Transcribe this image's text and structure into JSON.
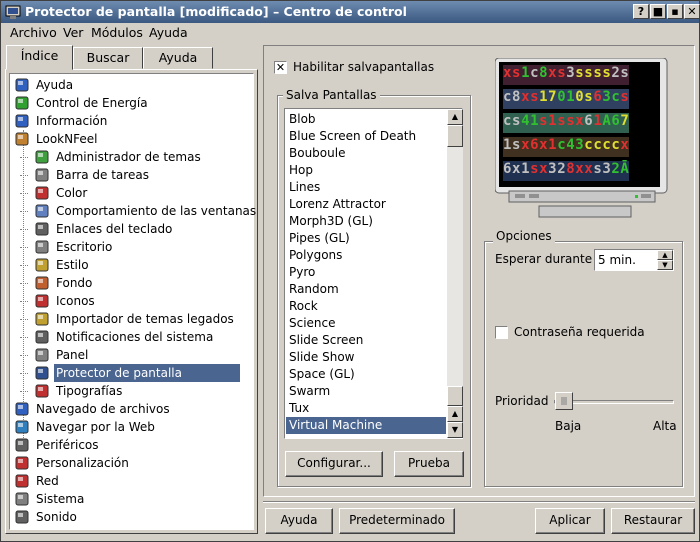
{
  "window": {
    "title": "Protector de pantalla [modificado] – Centro de control",
    "controls": [
      "?",
      "■",
      "▪",
      "✕"
    ]
  },
  "menu": [
    "Archivo",
    "Ver",
    "Módulos",
    "Ayuda"
  ],
  "tabs": [
    "Índice",
    "Buscar",
    "Ayuda"
  ],
  "tree": [
    {
      "label": "Ayuda",
      "icon": "help-icon",
      "level": 0
    },
    {
      "label": "Control de Energía",
      "icon": "energy-icon",
      "level": 0
    },
    {
      "label": "Información",
      "icon": "info-icon",
      "level": 0
    },
    {
      "label": "LookNFeel",
      "icon": "looknfeel-icon",
      "level": 0
    },
    {
      "label": "Administrador de temas",
      "icon": "theme-manager-icon",
      "level": 1
    },
    {
      "label": "Barra de tareas",
      "icon": "taskbar-icon",
      "level": 1
    },
    {
      "label": "Color",
      "icon": "color-icon",
      "level": 1
    },
    {
      "label": "Comportamiento de las ventanas",
      "icon": "window-behavior-icon",
      "level": 1
    },
    {
      "label": "Enlaces del teclado",
      "icon": "keyboard-icon",
      "level": 1
    },
    {
      "label": "Escritorio",
      "icon": "desktop-icon",
      "level": 1
    },
    {
      "label": "Estilo",
      "icon": "style-icon",
      "level": 1
    },
    {
      "label": "Fondo",
      "icon": "background-icon",
      "level": 1
    },
    {
      "label": "Iconos",
      "icon": "icons-icon",
      "level": 1
    },
    {
      "label": "Importador de temas legados",
      "icon": "theme-importer-icon",
      "level": 1
    },
    {
      "label": "Notificaciones del sistema",
      "icon": "notifications-icon",
      "level": 1
    },
    {
      "label": "Panel",
      "icon": "panel-icon",
      "level": 1
    },
    {
      "label": "Protector de pantalla",
      "icon": "screensaver-icon",
      "level": 1,
      "selected": true
    },
    {
      "label": "Tipografías",
      "icon": "fonts-icon",
      "level": 1
    },
    {
      "label": "Navegado de archivos",
      "icon": "file-browsing-icon",
      "level": 0
    },
    {
      "label": "Navegar por la Web",
      "icon": "web-icon",
      "level": 0
    },
    {
      "label": "Periféricos",
      "icon": "peripherals-icon",
      "level": 0
    },
    {
      "label": "Personalización",
      "icon": "personalization-icon",
      "level": 0
    },
    {
      "label": "Red",
      "icon": "network-icon",
      "level": 0
    },
    {
      "label": "Sistema",
      "icon": "system-icon",
      "level": 0
    },
    {
      "label": "Sonido",
      "icon": "sound-icon",
      "level": 0
    }
  ],
  "enable": {
    "label": "Habilitar salvapantallas",
    "checked": true
  },
  "savers": {
    "title": "Salva Pantallas",
    "items": [
      "Blob",
      "Blue Screen of Death",
      "Bouboule",
      "Hop",
      "Lines",
      "Lorenz Attractor",
      "Morph3D (GL)",
      "Pipes (GL)",
      "Polygons",
      "Pyro",
      "Random",
      "Rock",
      "Science",
      "Slide Screen",
      "Slide Show",
      "Space (GL)",
      "Swarm",
      "Tux",
      "Virtual Machine"
    ],
    "selected": "Virtual Machine",
    "configure": "Configurar...",
    "test": "Prueba"
  },
  "preview": {
    "rows": [
      [
        [
          "x",
          "#e03030"
        ],
        [
          "s",
          "#e03030"
        ],
        [
          "1",
          "#30c030"
        ],
        [
          "c",
          "#c0c0c0"
        ],
        [
          "8",
          "#30c030"
        ],
        [
          "x",
          "#e03030"
        ],
        [
          "s",
          "#e03030"
        ],
        [
          "3",
          "#c0c0c0"
        ],
        [
          "s",
          "#e0e030"
        ],
        [
          "s",
          "#e0e030"
        ],
        [
          "s",
          "#e0e030"
        ],
        [
          "s",
          "#e0e030"
        ],
        [
          "2",
          "#c0c0c0"
        ],
        [
          "s",
          "#c0c0c0"
        ]
      ],
      [
        [
          "c",
          "#c0c0c0"
        ],
        [
          "8",
          "#c0c0c0"
        ],
        [
          "x",
          "#e03030"
        ],
        [
          "s",
          "#e03030"
        ],
        [
          "1",
          "#e0e030"
        ],
        [
          "7",
          "#e0e030"
        ],
        [
          "0",
          "#30c030"
        ],
        [
          "1",
          "#30c030"
        ],
        [
          "0",
          "#e0e030"
        ],
        [
          "s",
          "#e0e030"
        ],
        [
          "6",
          "#e03030"
        ],
        [
          "3",
          "#30c030"
        ],
        [
          "c",
          "#30c030"
        ],
        [
          "s",
          "#e03030"
        ]
      ],
      [
        [
          "c",
          "#c0c0c0"
        ],
        [
          "s",
          "#c0c0c0"
        ],
        [
          "4",
          "#30c030"
        ],
        [
          "1",
          "#30c030"
        ],
        [
          "s",
          "#e03030"
        ],
        [
          "1",
          "#e03030"
        ],
        [
          "s",
          "#e03030"
        ],
        [
          "s",
          "#e03030"
        ],
        [
          "x",
          "#e03030"
        ],
        [
          "6",
          "#c0c0c0"
        ],
        [
          "1",
          "#e03030"
        ],
        [
          "A",
          "#30c030"
        ],
        [
          "6",
          "#30c030"
        ],
        [
          "7",
          "#e0e030"
        ]
      ],
      [
        [
          "1",
          "#c0c0c0"
        ],
        [
          "s",
          "#c0c0c0"
        ],
        [
          "x",
          "#e03030"
        ],
        [
          "6",
          "#e03030"
        ],
        [
          "x",
          "#e03030"
        ],
        [
          "1",
          "#e03030"
        ],
        [
          "c",
          "#30c030"
        ],
        [
          "4",
          "#30c030"
        ],
        [
          "3",
          "#30c030"
        ],
        [
          "c",
          "#e0e030"
        ],
        [
          "c",
          "#e0e030"
        ],
        [
          "c",
          "#e0e030"
        ],
        [
          "c",
          "#e0e030"
        ],
        [
          "x",
          "#e03030"
        ]
      ],
      [
        [
          "6",
          "#c0c0c0"
        ],
        [
          "x",
          "#c0c0c0"
        ],
        [
          "1",
          "#c0c0c0"
        ],
        [
          "s",
          "#e03030"
        ],
        [
          "x",
          "#e03030"
        ],
        [
          "3",
          "#c0c0c0"
        ],
        [
          "2",
          "#c0c0c0"
        ],
        [
          "8",
          "#e03030"
        ],
        [
          "x",
          "#e03030"
        ],
        [
          "x",
          "#e03030"
        ],
        [
          "s",
          "#c0c0c0"
        ],
        [
          "3",
          "#c0c0c0"
        ],
        [
          "2",
          "#30c030"
        ],
        [
          "Ā",
          "#30c030"
        ]
      ]
    ],
    "bgs": [
      "#402030",
      "#304060",
      "#306050",
      "#403020",
      "#203050"
    ]
  },
  "options": {
    "title": "Opciones",
    "wait_label": "Esperar durante",
    "wait_value": "5 min.",
    "password_label": "Contraseña requerida",
    "password_checked": false,
    "priority_label": "Prioridad",
    "priority_low": "Baja",
    "priority_high": "Alta",
    "priority_value": 0
  },
  "buttons": {
    "help": "Ayuda",
    "defaults": "Predeterminado",
    "apply": "Aplicar",
    "restore": "Restaurar"
  }
}
